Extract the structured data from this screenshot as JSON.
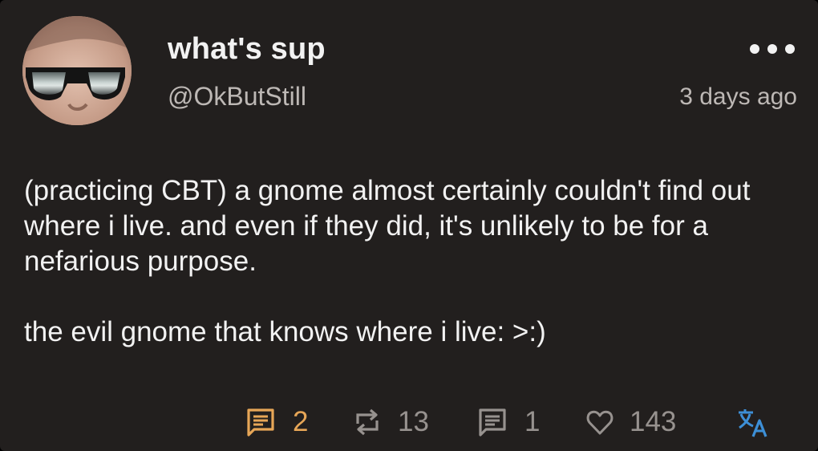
{
  "post": {
    "display_name": "what's sup",
    "handle": "@OkButStill",
    "timestamp": "3 days ago",
    "body": [
      "(practicing CBT) a gnome almost certainly couldn't find out where i live. and even if they did, it's unlikely to be for a nefarious purpose.",
      "the evil gnome that knows where i live:  >:)"
    ]
  },
  "actions": {
    "comments": {
      "icon": "comment-icon",
      "count": "2",
      "color": "#e7a657"
    },
    "reposts": {
      "icon": "repost-icon",
      "count": "13",
      "color": "#97928f"
    },
    "quotes": {
      "icon": "quote-icon",
      "count": "1",
      "color": "#97928f"
    },
    "likes": {
      "icon": "heart-icon",
      "count": "143",
      "color": "#97928f"
    },
    "translate": {
      "icon": "translate-icon",
      "color": "#3d8fd6"
    }
  },
  "colors": {
    "card_background": "#221f1e",
    "text_primary": "#f2f2f2",
    "text_secondary": "#bdb8b5",
    "accent": "#e7a657"
  }
}
